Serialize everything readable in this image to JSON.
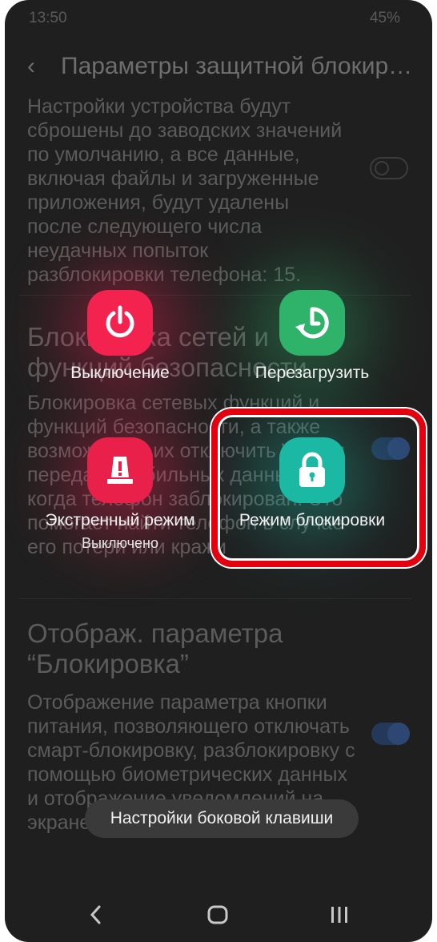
{
  "status_bar": {
    "time": "13:50",
    "battery": "45%"
  },
  "header": {
    "title": "Параметры защитной блокиров..."
  },
  "settings": {
    "item1": {
      "description": "Настройки устройства будут сброшены до заводских значений по умолчанию, а все данные, включая файлы и загруженные приложения, будут удалены после следующего числа неудачных попыток разблокировки телефона: 15.",
      "toggle": "off"
    },
    "item2": {
      "title": "Блокировка сетей и функций безопасности",
      "description": "Блокировка сетевых функций и функций безопасности, а также возможность их отключить Wi-Fi и передачу мобильных данных, когда телефон заблокирован. Это помогает найти телефон в случае его потери или кражи",
      "toggle": "on"
    },
    "item3": {
      "title": "Отображ. параметра “Блокировка”",
      "description": "Отображение параметра кнопки питания, позволяющего отключать смарт-блокировку, разблокировку с помощью биометрических данных и отображение уведомлений на экране блокировки.",
      "toggle": "on"
    }
  },
  "power_menu": {
    "power_off": {
      "label": "Выключение",
      "icon": "power-icon",
      "color": "#f3224f"
    },
    "restart": {
      "label": "Перезагрузить",
      "icon": "restart-icon",
      "color": "#2fb36a"
    },
    "emergency": {
      "label": "Экстренный режим",
      "sub": "Выключено",
      "icon": "emergency-light-icon",
      "color": "#e8204a"
    },
    "lockdown": {
      "label": "Режим блокировки",
      "icon": "lock-icon",
      "color": "#1bb9a3"
    },
    "highlight_color": "#e3000f"
  },
  "side_key": {
    "label": "Настройки боковой клавиши"
  },
  "navbar": {
    "back": "back-icon",
    "home": "home-icon",
    "recents": "recents-icon"
  }
}
